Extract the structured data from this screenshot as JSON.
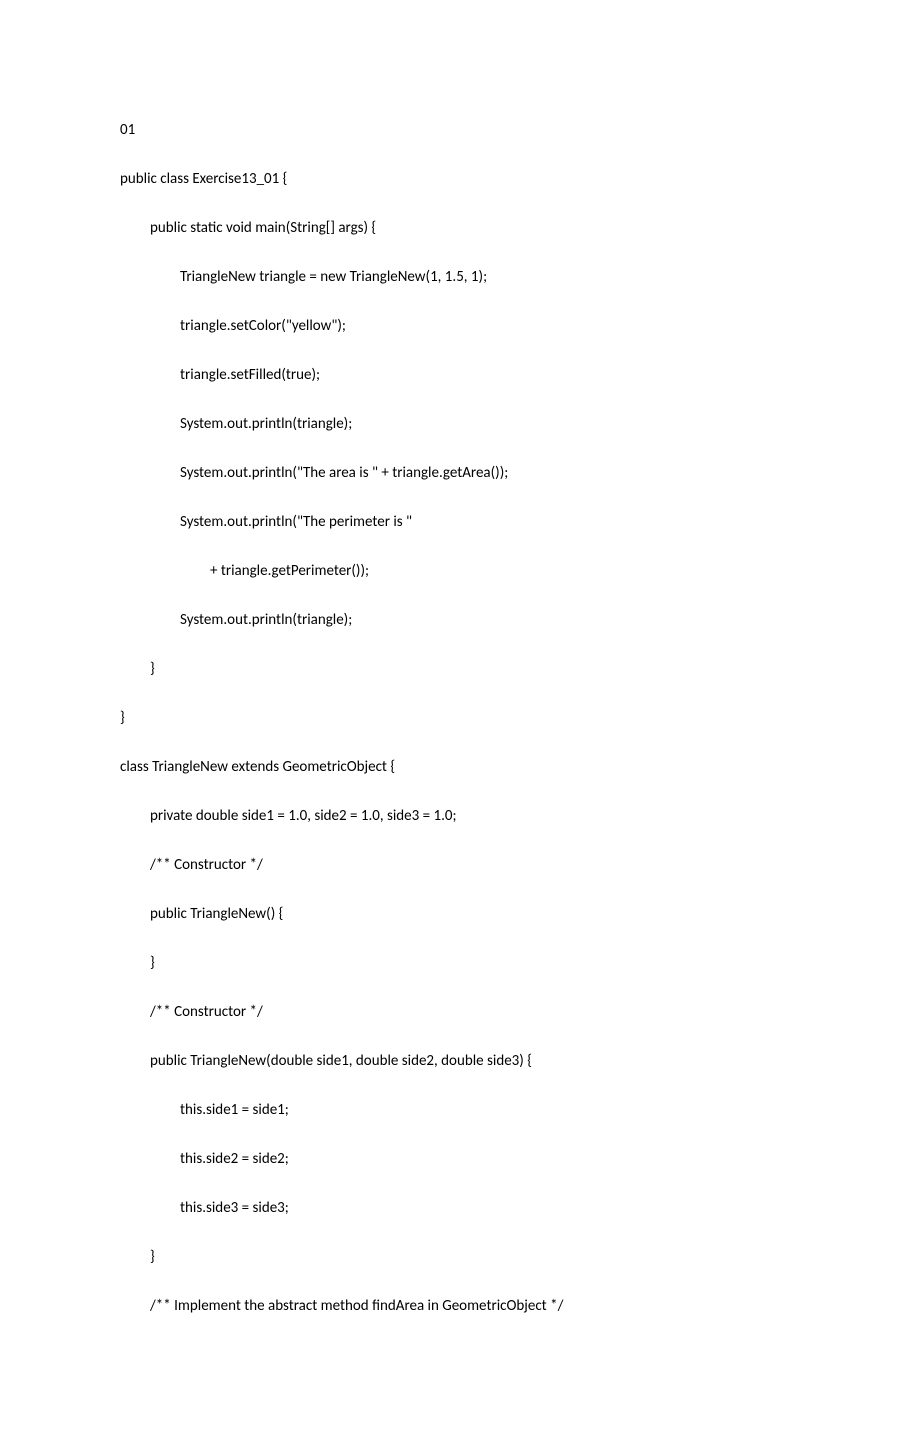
{
  "lines": [
    {
      "indent": 0,
      "text": "01"
    },
    {
      "indent": 0,
      "text": "public class Exercise13_01 {"
    },
    {
      "indent": 1,
      "text": "public static void main(String[] args) {"
    },
    {
      "indent": 2,
      "text": "TriangleNew triangle = new TriangleNew(1, 1.5, 1);"
    },
    {
      "indent": 2,
      "text": "triangle.setColor(\"yellow\");"
    },
    {
      "indent": 2,
      "text": "triangle.setFilled(true);"
    },
    {
      "indent": 2,
      "text": "System.out.println(triangle);"
    },
    {
      "indent": 2,
      "text": "System.out.println(\"The area is \" + triangle.getArea());"
    },
    {
      "indent": 2,
      "text": "System.out.println(\"The perimeter is \""
    },
    {
      "indent": 3,
      "text": "+ triangle.getPerimeter());"
    },
    {
      "indent": 2,
      "text": "System.out.println(triangle);"
    },
    {
      "indent": 1,
      "text": "}"
    },
    {
      "indent": 0,
      "text": "}"
    },
    {
      "indent": 0,
      "text": "class TriangleNew extends GeometricObject {"
    },
    {
      "indent": 1,
      "text": "private double side1 = 1.0, side2 = 1.0, side3 = 1.0;"
    },
    {
      "indent": 1,
      "text": "/** Constructor */"
    },
    {
      "indent": 1,
      "text": "public TriangleNew() {"
    },
    {
      "indent": 1,
      "text": "}"
    },
    {
      "indent": 1,
      "text": "/** Constructor */"
    },
    {
      "indent": 1,
      "text": "public TriangleNew(double side1, double side2, double side3) {"
    },
    {
      "indent": 2,
      "text": "this.side1 = side1;"
    },
    {
      "indent": 2,
      "text": "this.side2 = side2;"
    },
    {
      "indent": 2,
      "text": "this.side3 = side3;"
    },
    {
      "indent": 1,
      "text": "}"
    },
    {
      "indent": 1,
      "text": "/** Implement the abstract method findArea in GeometricObject */"
    }
  ]
}
